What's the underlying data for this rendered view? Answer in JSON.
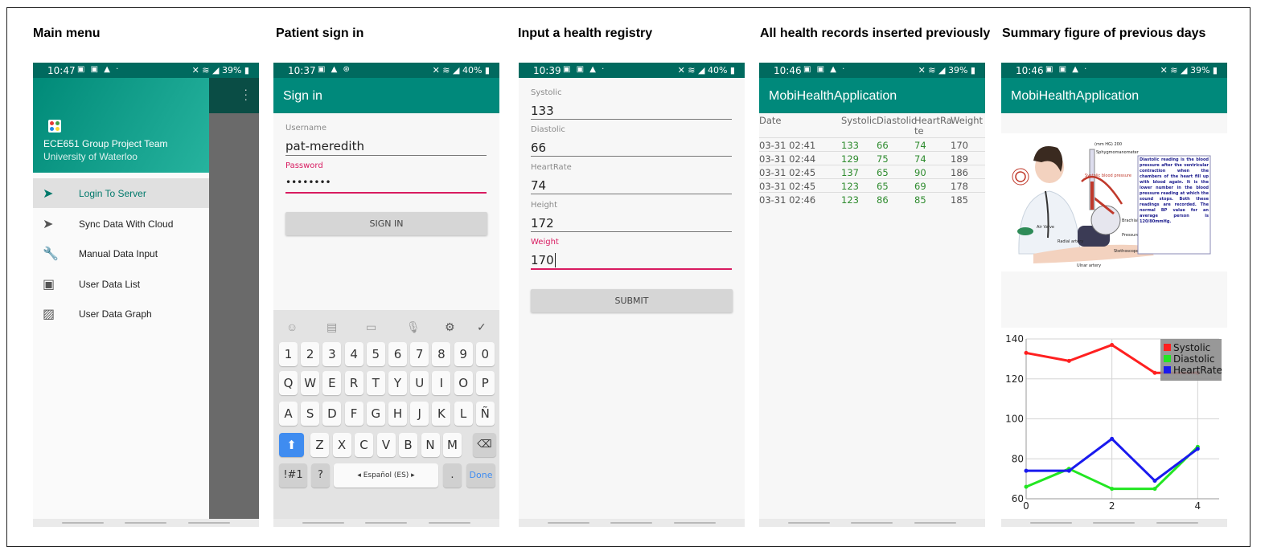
{
  "captions": [
    "Main menu",
    "Patient sign in",
    "Input a health registry",
    "All health records inserted previously",
    "Summary figure of previous days"
  ],
  "screens": {
    "menu": {
      "time": "10:47",
      "battery": "39%",
      "team": "ECE651 Group Project Team",
      "university": "University of Waterloo",
      "items": [
        {
          "label": "Login To Server",
          "icon": "send-icon"
        },
        {
          "label": "Sync Data With Cloud",
          "icon": "send-icon"
        },
        {
          "label": "Manual Data Input",
          "icon": "wrench-icon"
        },
        {
          "label": "User Data List",
          "icon": "video-library-icon"
        },
        {
          "label": "User Data Graph",
          "icon": "image-library-icon"
        }
      ]
    },
    "signin": {
      "time": "10:37",
      "battery": "40%",
      "title": "Sign in",
      "username_label": "Username",
      "username_value": "pat-meredith",
      "password_label": "Password",
      "password_value": "••••••••",
      "button": "SIGN IN",
      "keyboard": {
        "row1": [
          "1",
          "2",
          "3",
          "4",
          "5",
          "6",
          "7",
          "8",
          "9",
          "0"
        ],
        "row2": [
          "Q",
          "W",
          "E",
          "R",
          "T",
          "Y",
          "U",
          "I",
          "O",
          "P"
        ],
        "row3": [
          "A",
          "S",
          "D",
          "F",
          "G",
          "H",
          "J",
          "K",
          "L",
          "Ñ"
        ],
        "row4": [
          "Z",
          "X",
          "C",
          "V",
          "B",
          "N",
          "M"
        ],
        "sym": "!#1",
        "question": "?",
        "space": "◂ Español (ES) ▸",
        "dot": ".",
        "done": "Done"
      }
    },
    "registry": {
      "time": "10:39",
      "battery": "40%",
      "fields": [
        {
          "label": "Systolic",
          "value": "133"
        },
        {
          "label": "Diastolic",
          "value": "66"
        },
        {
          "label": "HeartRate",
          "value": "74"
        },
        {
          "label": "Height",
          "value": "172"
        },
        {
          "label": "Weight",
          "value": "170"
        }
      ],
      "button": "SUBMIT"
    },
    "records": {
      "time": "10:46",
      "battery": "39%",
      "title": "MobiHealthApplication",
      "headers": {
        "date": "Date",
        "systolic": "Systolic",
        "diastolic": "Diastolic",
        "heartrate_1": "HeartRa",
        "heartrate_2": "te",
        "weight": "Weight"
      },
      "rows": [
        {
          "date": "03-31 02:41",
          "sys": "133",
          "dia": "66",
          "hr": "74",
          "w": "170"
        },
        {
          "date": "03-31 02:44",
          "sys": "129",
          "dia": "75",
          "hr": "74",
          "w": "189"
        },
        {
          "date": "03-31 02:45",
          "sys": "137",
          "dia": "65",
          "hr": "90",
          "w": "186"
        },
        {
          "date": "03-31 02:45",
          "sys": "123",
          "dia": "65",
          "hr": "69",
          "w": "178"
        },
        {
          "date": "03-31 02:46",
          "sys": "123",
          "dia": "86",
          "hr": "85",
          "w": "185"
        }
      ]
    },
    "summary": {
      "time": "10:46",
      "battery": "39%",
      "title": "MobiHealthApplication",
      "illustration_text": {
        "sphyg": "Sphygmomanometer",
        "systolic_bp": "Systolic blood pressure",
        "air_valve": "Air Valve",
        "radial": "Radial artery",
        "brachial": "Brachial artery",
        "pressure_cuff": "Pressure cuff",
        "stethoscope": "Stethoscope Position",
        "ulnar": "Ulnar artery",
        "mmhg": "(mm HG) 200",
        "info": "Diastolic reading is the blood pressure after the ventricular contraction when the chambers of the heart fill up with blood again. It is the lower number in the blood pressure reading at which the sound stops. Both these readings are recorded. The normal BP value for an average person is 120/80mmHg."
      }
    }
  },
  "chart_data": {
    "type": "line",
    "x": [
      0,
      1,
      2,
      3,
      4
    ],
    "series": [
      {
        "name": "Systolic",
        "color": "#ff2020",
        "values": [
          133,
          129,
          137,
          123,
          123
        ]
      },
      {
        "name": "Diastolic",
        "color": "#22e622",
        "values": [
          66,
          75,
          65,
          65,
          86
        ]
      },
      {
        "name": "HeartRate",
        "color": "#1a1aee",
        "values": [
          74,
          74,
          90,
          69,
          85
        ]
      }
    ],
    "xticks": [
      "0",
      "2",
      "4"
    ],
    "yticks": [
      "60",
      "80",
      "100",
      "120",
      "140"
    ],
    "xlim": [
      0,
      4.5
    ],
    "ylim": [
      60,
      140
    ],
    "grid": true,
    "legend": "top-right"
  }
}
